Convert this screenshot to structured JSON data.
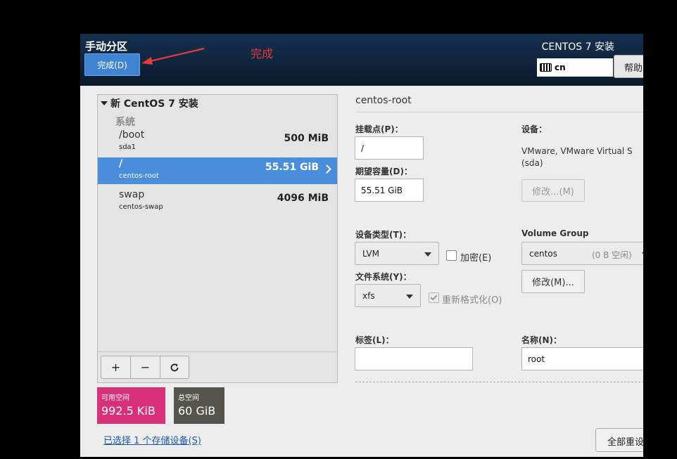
{
  "header": {
    "title": "手动分区",
    "done_label": "完成(D)",
    "install_title": "CENTOS 7 安装",
    "keyboard_layout": "cn",
    "help_label": "帮助"
  },
  "annotation": {
    "text": "完成",
    "color": "#e8383f"
  },
  "partitions": {
    "install_header": "新 CentOS 7 安装",
    "system_label": "系统",
    "items": [
      {
        "name": "/boot",
        "device": "sda1",
        "size": "500 MiB",
        "selected": false
      },
      {
        "name": "/",
        "device": "centos-root",
        "size": "55.51 GiB",
        "selected": true
      },
      {
        "name": "swap",
        "device": "centos-swap",
        "size": "4096 MiB",
        "selected": false
      }
    ],
    "add_label": "+",
    "remove_label": "−",
    "refresh_label": "⟳"
  },
  "space": {
    "available_label": "可用空间",
    "available_value": "992.5 KiB",
    "total_label": "总空间",
    "total_value": "60 GiB",
    "storage_link": "已选择 1 个存储设备(S)"
  },
  "detail": {
    "title": "centos-root",
    "mount_point_label": "挂载点(P)：",
    "mount_point_value": "/",
    "capacity_label": "期望容量(D)：",
    "capacity_value": "55.51 GiB",
    "device_label": "设备：",
    "device_value": "VMware, VMware Virtual S (sda)",
    "device_modify_label": "修改...(M)",
    "device_type_label": "设备类型(T)：",
    "device_type_value": "LVM",
    "encrypt_label": "加密(E)",
    "encrypt_checked": false,
    "filesystem_label": "文件系统(Y)：",
    "filesystem_value": "xfs",
    "reformat_label": "重新格式化(O)",
    "reformat_checked": true,
    "volume_group_label": "Volume Group",
    "volume_group_value": "centos",
    "volume_group_free": "(0 B 空闲)",
    "volume_group_modify_label": "修改(M)...",
    "tag_label": "标签(L)：",
    "tag_value": "",
    "name_label": "名称(N)：",
    "name_value": "root",
    "reset_all_label": "全部重设"
  },
  "colors": {
    "header_bg": "#0d1e33",
    "accent": "#3e84d3",
    "selected_row": "#4a8edb",
    "available_space": "#d8317a",
    "total_space": "#55544f"
  }
}
